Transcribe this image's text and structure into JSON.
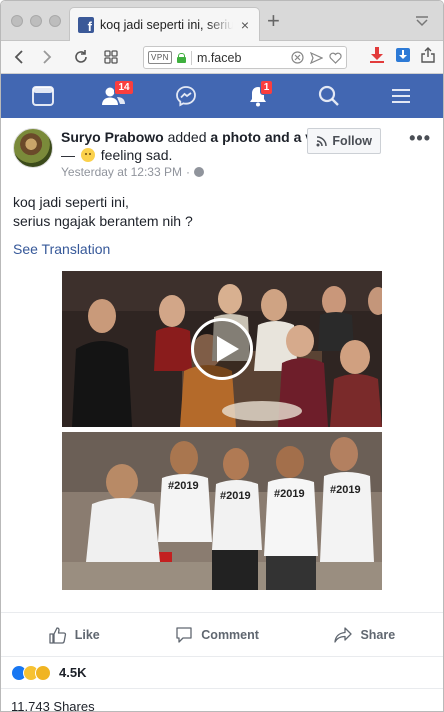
{
  "browser": {
    "tab_title": "koq jadi seperti ini, serius ngajak berantem nih ?",
    "url": "m.faceb",
    "vpn_label": "VPN",
    "accent_download": "#e23b3b",
    "accent_save": "#2d7ad6"
  },
  "fb_nav": {
    "bar_color": "#4267b2",
    "items": [
      {
        "icon": "news-feed-icon"
      },
      {
        "icon": "friend-requests-icon",
        "badge": "14"
      },
      {
        "icon": "messenger-icon"
      },
      {
        "icon": "notifications-icon",
        "badge": "1"
      },
      {
        "icon": "search-icon"
      },
      {
        "icon": "menu-icon"
      }
    ]
  },
  "post": {
    "author": "Suryo Prabowo",
    "verb": "added",
    "object": "a photo and a video",
    "feeling_dash": "—",
    "feeling": "feeling sad.",
    "timestamp": "Yesterday at 12:33 PM",
    "meta_sep": "·",
    "follow_label": "Follow",
    "text_line1": "koq jadi seperti ini,",
    "text_line2": "serius ngajak berantem nih ?",
    "see_translation": "See Translation"
  },
  "photo2_shirts": [
    "#2019",
    "#2019",
    "#2019",
    "#2019"
  ],
  "actions": {
    "like": "Like",
    "comment": "Comment",
    "share": "Share"
  },
  "reactions": {
    "count": "4.5K",
    "types": [
      "like",
      "haha",
      "wow"
    ]
  },
  "shares_text": "11,743 Shares"
}
